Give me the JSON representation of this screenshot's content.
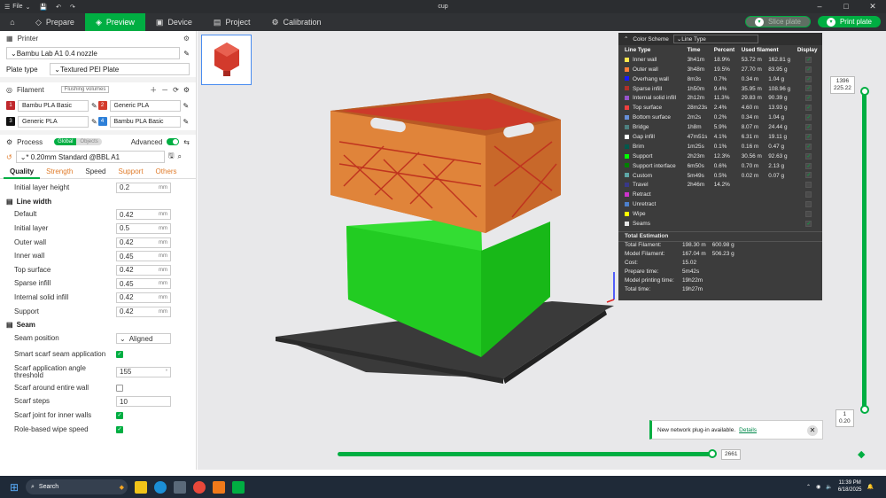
{
  "titlebar": {
    "menu": "File",
    "title": "cup"
  },
  "nav": {
    "prepare": "Prepare",
    "preview": "Preview",
    "device": "Device",
    "project": "Project",
    "calibration": "Calibration",
    "slice": "Slice plate",
    "print": "Print plate"
  },
  "printer": {
    "header": "Printer",
    "name": "Bambu Lab A1 0.4 nozzle",
    "plate_label": "Plate type",
    "plate_value": "Textured PEI Plate"
  },
  "filament": {
    "header": "Filament",
    "flush": "Flushing volumes",
    "items": [
      {
        "num": "1",
        "name": "Bambu PLA Basic",
        "color": "#c0282d"
      },
      {
        "num": "2",
        "name": "Generic PLA",
        "color": "#d33b2c"
      },
      {
        "num": "3",
        "name": "Generic PLA",
        "color": "#111111"
      },
      {
        "num": "4",
        "name": "Bambu PLA Basic",
        "color": "#2d7fd8"
      }
    ]
  },
  "process": {
    "header": "Process",
    "global": "Global",
    "objects": "Objects",
    "advanced": "Advanced",
    "preset": "* 0.20mm Standard @BBL A1"
  },
  "tabs": [
    "Quality",
    "Strength",
    "Speed",
    "Support",
    "Others"
  ],
  "quality": {
    "initial_layer_height": {
      "label": "Initial layer height",
      "value": "0.2",
      "unit": "mm"
    },
    "line_width_title": "Line width",
    "line_width": [
      {
        "label": "Default",
        "value": "0.42",
        "unit": "mm"
      },
      {
        "label": "Initial layer",
        "value": "0.5",
        "unit": "mm"
      },
      {
        "label": "Outer wall",
        "value": "0.42",
        "unit": "mm"
      },
      {
        "label": "Inner wall",
        "value": "0.45",
        "unit": "mm"
      },
      {
        "label": "Top surface",
        "value": "0.42",
        "unit": "mm"
      },
      {
        "label": "Sparse infill",
        "value": "0.45",
        "unit": "mm"
      },
      {
        "label": "Internal solid infill",
        "value": "0.42",
        "unit": "mm"
      },
      {
        "label": "Support",
        "value": "0.42",
        "unit": "mm"
      }
    ],
    "seam_title": "Seam",
    "seam_position": {
      "label": "Seam position",
      "value": "Aligned"
    },
    "smart_scarf": {
      "label": "Smart scarf seam application",
      "checked": true
    },
    "scarf_angle": {
      "label": "Scarf application angle threshold",
      "value": "155",
      "unit": "°"
    },
    "scarf_entire": {
      "label": "Scarf around entire wall",
      "checked": false
    },
    "scarf_steps": {
      "label": "Scarf steps",
      "value": "10"
    },
    "scarf_inner": {
      "label": "Scarf joint for inner walls",
      "checked": true
    },
    "role_wipe": {
      "label": "Role-based wipe speed",
      "checked": true
    }
  },
  "legend": {
    "title": "Color Scheme",
    "scheme": "Line Type",
    "headers": [
      "Line Type",
      "Time",
      "Percent",
      "Used filament",
      "Display"
    ],
    "rows": [
      {
        "name": "Inner wall",
        "time": "3h41m",
        "pct": "18.9%",
        "len": "53.72 m",
        "g": "162.81 g",
        "color": "#ffe64d",
        "shown": true
      },
      {
        "name": "Outer wall",
        "time": "3h48m",
        "pct": "19.5%",
        "len": "27.70 m",
        "g": "83.95 g",
        "color": "#ff7d38",
        "shown": true
      },
      {
        "name": "Overhang wall",
        "time": "8m3s",
        "pct": "0.7%",
        "len": "0.34 m",
        "g": "1.04 g",
        "color": "#1919ff",
        "shown": true
      },
      {
        "name": "Sparse infill",
        "time": "1h50m",
        "pct": "9.4%",
        "len": "35.95 m",
        "g": "108.96 g",
        "color": "#b03029",
        "shown": true
      },
      {
        "name": "Internal solid infill",
        "time": "2h12m",
        "pct": "11.3%",
        "len": "29.83 m",
        "g": "90.39 g",
        "color": "#9654cc",
        "shown": true
      },
      {
        "name": "Top surface",
        "time": "28m23s",
        "pct": "2.4%",
        "len": "4.60 m",
        "g": "13.93 g",
        "color": "#f04040",
        "shown": true
      },
      {
        "name": "Bottom surface",
        "time": "2m2s",
        "pct": "0.2%",
        "len": "0.34 m",
        "g": "1.04 g",
        "color": "#668fd8",
        "shown": true
      },
      {
        "name": "Bridge",
        "time": "1h8m",
        "pct": "5.9%",
        "len": "8.07 m",
        "g": "24.44 g",
        "color": "#4d8080",
        "shown": true
      },
      {
        "name": "Gap infill",
        "time": "47m51s",
        "pct": "4.1%",
        "len": "6.31 m",
        "g": "19.11 g",
        "color": "#ffffff",
        "shown": true
      },
      {
        "name": "Brim",
        "time": "1m25s",
        "pct": "0.1%",
        "len": "0.16 m",
        "g": "0.47 g",
        "color": "#00594c",
        "shown": true
      },
      {
        "name": "Support",
        "time": "2h23m",
        "pct": "12.3%",
        "len": "30.56 m",
        "g": "92.63 g",
        "color": "#00ff00",
        "shown": true
      },
      {
        "name": "Support interface",
        "time": "6m50s",
        "pct": "0.6%",
        "len": "0.70 m",
        "g": "2.13 g",
        "color": "#008000",
        "shown": true
      },
      {
        "name": "Custom",
        "time": "5m49s",
        "pct": "0.5%",
        "len": "0.02 m",
        "g": "0.07 g",
        "color": "#5ea6a6",
        "shown": true
      },
      {
        "name": "Travel",
        "time": "2h46m",
        "pct": "14.2%",
        "len": "",
        "g": "",
        "color": "#383888",
        "shown": false
      },
      {
        "name": "Retract",
        "time": "",
        "pct": "",
        "len": "",
        "g": "",
        "color": "#cc33cc",
        "shown": false
      },
      {
        "name": "Unretract",
        "time": "",
        "pct": "",
        "len": "",
        "g": "",
        "color": "#4d80cc",
        "shown": false
      },
      {
        "name": "Wipe",
        "time": "",
        "pct": "",
        "len": "",
        "g": "",
        "color": "#ffff00",
        "shown": false
      },
      {
        "name": "Seams",
        "time": "",
        "pct": "",
        "len": "",
        "g": "",
        "color": "#e6e6e6",
        "shown": true
      }
    ],
    "total_title": "Total Estimation",
    "totals": [
      {
        "k": "Total Filament:",
        "v": "198.30 m    600.98 g"
      },
      {
        "k": "Model Filament:",
        "v": "167.04 m    506.23 g"
      },
      {
        "k": "Cost:",
        "v": "15.02"
      },
      {
        "k": "Prepare time:",
        "v": "5m42s"
      },
      {
        "k": "Model printing time:",
        "v": "19h22m"
      },
      {
        "k": "Total time:",
        "v": "19h27m"
      }
    ]
  },
  "layer_slider": {
    "top_layer": "1396",
    "top_height": "225.22",
    "bottom_layer": "1",
    "bottom_height": "0.20"
  },
  "move_slider": {
    "value": "2661"
  },
  "notification": {
    "text": "New network plug-in available.",
    "link": "Details"
  },
  "taskbar": {
    "search": "Search",
    "time": "11:39 PM",
    "date": "6/18/2025"
  },
  "colors": {
    "accent": "#00ae42",
    "outer": "#d9762f",
    "support": "#2ee63a"
  }
}
